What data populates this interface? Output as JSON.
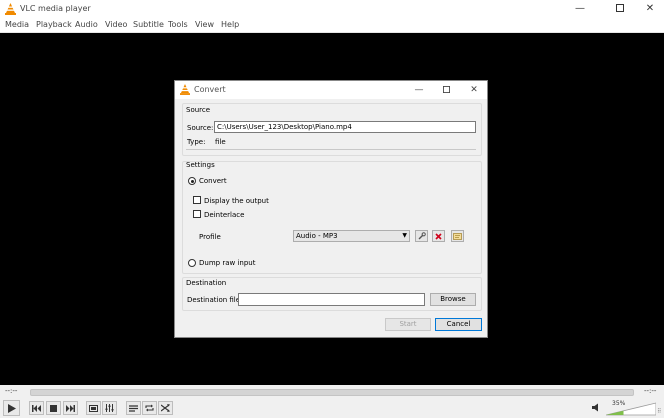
{
  "app": {
    "title": "VLC media player",
    "menu": [
      "Media",
      "Playback",
      "Audio",
      "Video",
      "Subtitle",
      "Tools",
      "View",
      "Help"
    ]
  },
  "player": {
    "time_elapsed": "--:--",
    "time_total": "--:--",
    "volume_percent": "35%",
    "volume_level": 0.35
  },
  "dialog": {
    "title": "Convert",
    "source": {
      "group_label": "Source",
      "source_label": "Source:",
      "source_value": "C:\\Users\\User_123\\Desktop\\Piano.mp4",
      "type_label": "Type:",
      "type_value": "file"
    },
    "settings": {
      "group_label": "Settings",
      "convert_label": "Convert",
      "display_output_label": "Display the output",
      "deinterlace_label": "Deinterlace",
      "profile_label": "Profile",
      "profile_value": "Audio - MP3",
      "dump_raw_label": "Dump raw input"
    },
    "destination": {
      "group_label": "Destination",
      "file_label": "Destination file:",
      "file_value": "",
      "browse_label": "Browse"
    },
    "start_label": "Start",
    "cancel_label": "Cancel"
  },
  "colors": {
    "vlc_orange": "#f08a00",
    "accent_blue": "#0078d7",
    "delete_red": "#d0021b"
  }
}
